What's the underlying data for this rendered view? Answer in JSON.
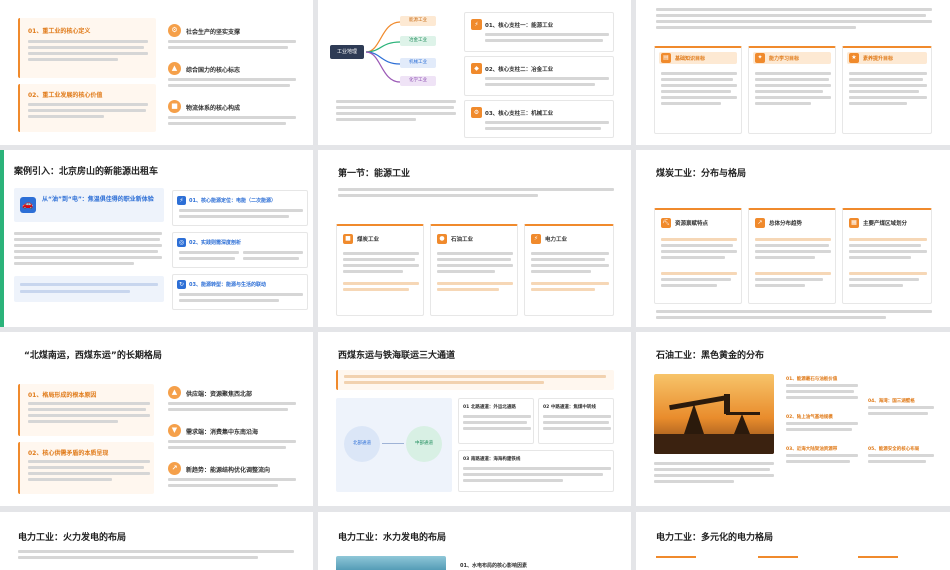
{
  "slides": {
    "s1": {
      "b1_title": "01、重工业的核心定义",
      "b2_title": "02、重工业发展的核心价值",
      "r1": "社会生产的坚实支撑",
      "r2": "综合国力的核心标志",
      "r3": "物流体系的核心构成"
    },
    "s2": {
      "mind_labels": [
        "能源工业",
        "冶金工业",
        "机械工业",
        "化学工业"
      ],
      "center_label": "工业地理",
      "k1": "01、核心支柱一：能源工业",
      "k2": "02、核心支柱二：冶金工业",
      "k3": "03、核心支柱三：机械工业"
    },
    "s3": {
      "c1": "基础知识目标",
      "c2": "能力学习目标",
      "c3": "素养提升目标"
    },
    "s4": {
      "title": "案例引入：北京房山的新能源出租车",
      "panel_title": "从“油”到“电”：焦温俱佳得的职业新体验",
      "i1": "01、核心能源定位：电能（二次能源）",
      "i2": "02、实践则需深度剖析",
      "i3": "03、能源转型：能源与生活的联动"
    },
    "s5": {
      "title": "第一节：能源工业",
      "cards": [
        "煤炭工业",
        "石油工业",
        "电力工业"
      ]
    },
    "s6": {
      "title": "煤炭工业：分布与格局",
      "cards": [
        "资源禀赋特点",
        "总体分布趋势",
        "主要产煤区域划分"
      ]
    },
    "s7": {
      "title": "“北煤南运，西煤东运”的长期格局",
      "b1_title": "01、格局形成的根本原因",
      "b2_title": "02、核心供需矛盾的本质呈现",
      "r1": "供应端：资源聚焦西北部",
      "r2": "需求端：消费集中东南沿海",
      "r3": "新趋势：能源结构优化调整流向"
    },
    "s8": {
      "title": "西煤东运与铁海联运三大通道",
      "node1": "北部通道",
      "node2": "中部通道",
      "n1": "01 北路通道：外运北通路",
      "n2": "02 中路通道：焦煤中转线",
      "n3": "03 南路通道：海海构建铁线"
    },
    "s9": {
      "title": "石油工业：黑色黄金的分布",
      "items": [
        "01、能源最石与油板价值",
        "02、陆上油气基地规模",
        "03、近海大陆架油资源带",
        "04、海湾：国三湖壁格",
        "05、能源安全的核心布局"
      ]
    },
    "s10": {
      "title": "电力工业：火力发电的布局"
    },
    "s11": {
      "title": "电力工业：水力发电的布局",
      "sub": "01、水电布局的核心影响因素"
    },
    "s12": {
      "title": "电力工业：多元化的电力格局"
    }
  },
  "colors": {
    "accent": "#f08a2c",
    "accent_dark": "#e07b1a",
    "blue": "#2d6fd6",
    "green": "#2bb37a"
  }
}
